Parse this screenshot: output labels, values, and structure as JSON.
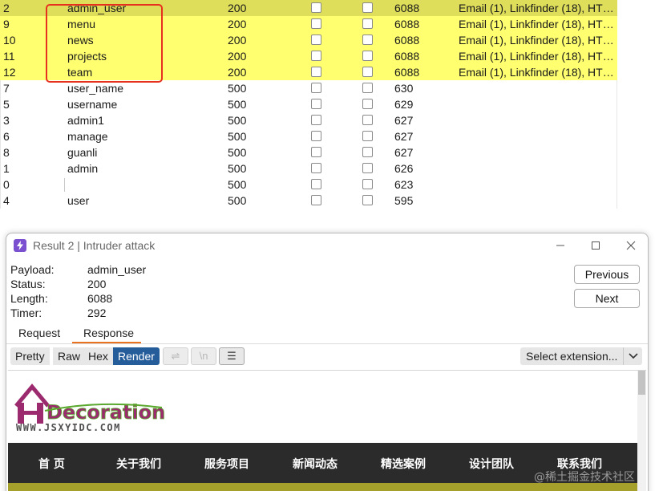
{
  "results": {
    "rows": [
      {
        "req": "2",
        "payload": "admin_user",
        "status": "200",
        "length": "6088",
        "comment": "Email (1), Linkfinder (18), HTM...",
        "state": "sel"
      },
      {
        "req": "9",
        "payload": "menu",
        "status": "200",
        "length": "6088",
        "comment": "Email (1), Linkfinder (18), HTM...",
        "state": "hl"
      },
      {
        "req": "10",
        "payload": "news",
        "status": "200",
        "length": "6088",
        "comment": "Email (1), Linkfinder (18), HTM...",
        "state": "hl"
      },
      {
        "req": "11",
        "payload": "projects",
        "status": "200",
        "length": "6088",
        "comment": "Email (1), Linkfinder (18), HTM...",
        "state": "hl"
      },
      {
        "req": "12",
        "payload": "team",
        "status": "200",
        "length": "6088",
        "comment": "Email (1), Linkfinder (18), HTM...",
        "state": "hl"
      },
      {
        "req": "7",
        "payload": "user_name",
        "status": "500",
        "length": "630",
        "comment": "",
        "state": ""
      },
      {
        "req": "5",
        "payload": "username",
        "status": "500",
        "length": "629",
        "comment": "",
        "state": ""
      },
      {
        "req": "3",
        "payload": "admin1",
        "status": "500",
        "length": "627",
        "comment": "",
        "state": ""
      },
      {
        "req": "6",
        "payload": "manage",
        "status": "500",
        "length": "627",
        "comment": "",
        "state": ""
      },
      {
        "req": "8",
        "payload": "guanli",
        "status": "500",
        "length": "627",
        "comment": "",
        "state": ""
      },
      {
        "req": "1",
        "payload": "admin",
        "status": "500",
        "length": "626",
        "comment": "",
        "state": ""
      },
      {
        "req": "0",
        "payload": "",
        "status": "500",
        "length": "623",
        "comment": "",
        "state": ""
      },
      {
        "req": "4",
        "payload": "user",
        "status": "500",
        "length": "595",
        "comment": "",
        "state": ""
      }
    ]
  },
  "dialog": {
    "title": "Result 2 | Intruder attack",
    "meta": {
      "payload_label": "Payload:",
      "payload": "admin_user",
      "status_label": "Status:",
      "status": "200",
      "length_label": "Length:",
      "length": "6088",
      "timer_label": "Timer:",
      "timer": "292"
    },
    "previous_label": "Previous",
    "next_label": "Next",
    "tabs": {
      "request": "Request",
      "response": "Response"
    },
    "toolbar": {
      "pretty": "Pretty",
      "raw": "Raw",
      "hex": "Hex",
      "render": "Render",
      "wrap_icon": "⇌",
      "newline_icon": "\\n",
      "menu_icon": "☰",
      "select_extension": "Select extension..."
    },
    "render": {
      "logo_text": "Decoration",
      "logo_url": "WWW.JSXYIDC.COM",
      "nav": [
        "首 页",
        "关于我们",
        "服务项目",
        "新闻动态",
        "精选案例",
        "设计团队",
        "联系我们"
      ]
    }
  },
  "watermark": "@稀土掘金技术社区",
  "colors": {
    "selected_row": "#dede5a",
    "highlight_row": "#ffff70",
    "annotation_box": "#e8301e",
    "render_active": "#255c9a",
    "response_tab_accent": "#e8721e",
    "site_nav_bg": "#2b2b2b",
    "logo_magenta": "#9c2a6f",
    "logo_green": "#5aa82e"
  }
}
